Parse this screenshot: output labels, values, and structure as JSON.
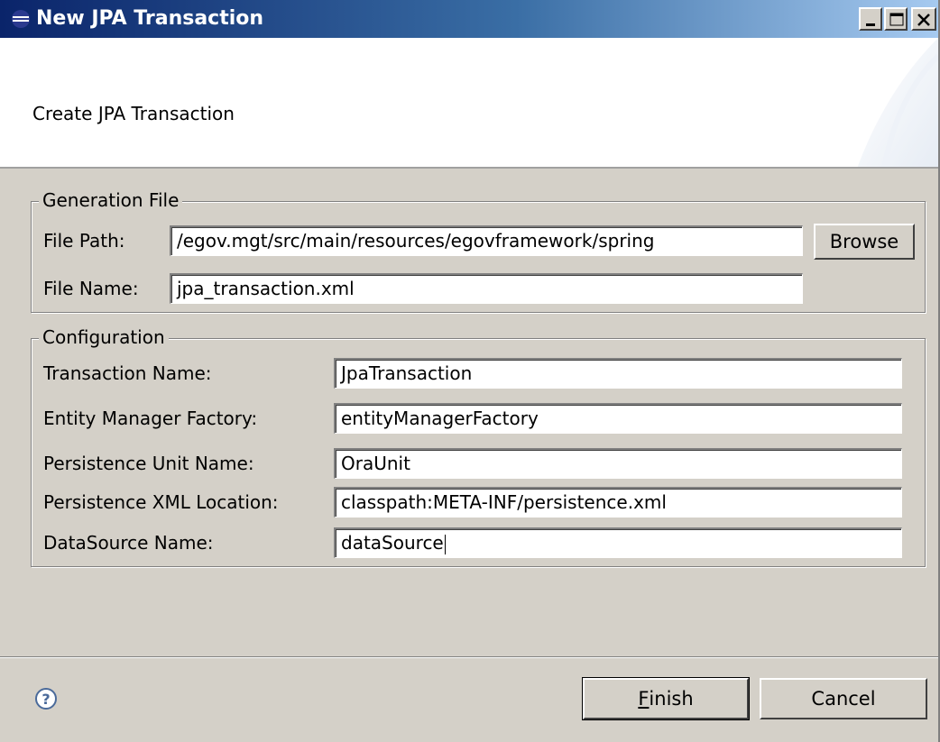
{
  "window": {
    "title": "New JPA Transaction"
  },
  "banner": {
    "description": "Create JPA Transaction"
  },
  "generation_file": {
    "legend": "Generation File",
    "file_path_label": "File Path:",
    "file_path_value": "/egov.mgt/src/main/resources/egovframework/spring",
    "browse_label": "Browse",
    "file_name_label": "File Name:",
    "file_name_value": "jpa_transaction.xml"
  },
  "configuration": {
    "legend": "Configuration",
    "rows": [
      {
        "label": "Transaction Name:",
        "value": "JpaTransaction"
      },
      {
        "label": "Entity Manager Factory:",
        "value": "entityManagerFactory"
      },
      {
        "label": "Persistence Unit Name:",
        "value": "OraUnit"
      },
      {
        "label": "Persistence XML Location:",
        "value": "classpath:META-INF/persistence.xml"
      },
      {
        "label": "DataSource Name:",
        "value": "dataSource"
      }
    ]
  },
  "footer": {
    "finish_mnemonic": "F",
    "finish_rest": "inish",
    "cancel_label": "Cancel"
  },
  "colors": {
    "titlebar_start": "#0a246a",
    "titlebar_end": "#a6caf0",
    "dialog_bg": "#d4d0c8"
  }
}
